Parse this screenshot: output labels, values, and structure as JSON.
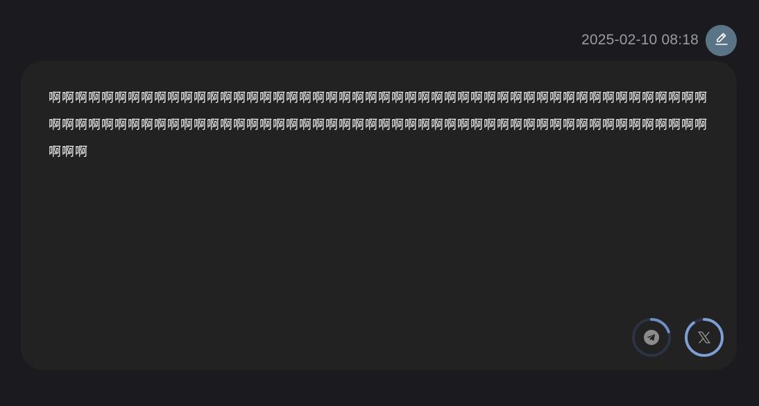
{
  "message": {
    "timestamp": "2025-02-10 08:18",
    "text": "啊啊啊啊啊啊啊啊啊啊啊啊啊啊啊啊啊啊啊啊啊啊啊啊啊啊啊啊啊啊啊啊啊啊啊啊啊啊啊啊啊啊啊啊啊啊啊啊啊啊啊啊啊啊啊啊啊啊啊啊啊啊啊啊啊啊啊啊啊啊啊啊啊啊啊啊啊啊啊啊啊啊啊啊啊啊啊啊啊啊啊啊啊啊啊啊啊啊啊啊啊啊啊"
  },
  "avatar": {
    "icon": "pencil-icon",
    "color": "#5a7485"
  },
  "share": {
    "telegram": {
      "icon": "telegram-icon",
      "progress": 0.2,
      "ring_color": "#6f8fc4",
      "track_color": "#2c3342"
    },
    "x": {
      "icon": "x-icon",
      "progress": 0.9,
      "ring_color": "#7d9fd6",
      "track_color": "#2c3342"
    }
  }
}
